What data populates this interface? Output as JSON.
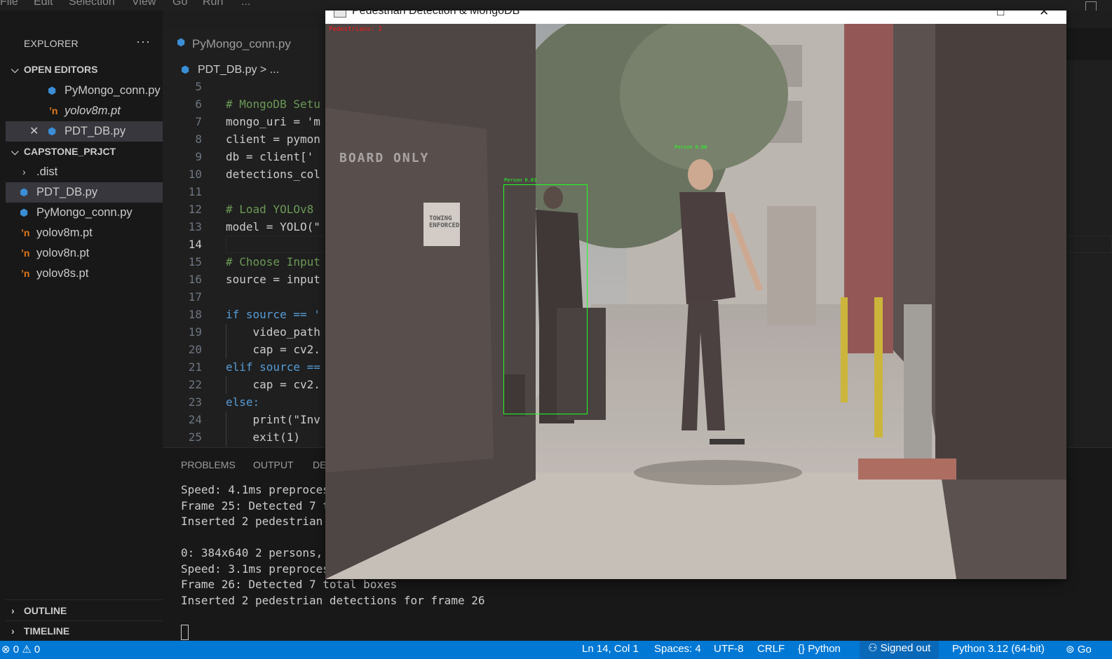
{
  "menu": {
    "items": [
      "File",
      "Edit",
      "Selection",
      "View",
      "Go",
      "Run",
      "..."
    ]
  },
  "explorer": {
    "title": "EXPLORER",
    "more": "···",
    "open_editors": {
      "label": "OPEN EDITORS",
      "files": [
        {
          "name": "PyMongo_conn.py",
          "icon": "python-file-icon"
        },
        {
          "name": "yolov8m.pt",
          "icon": "rss-file-icon"
        },
        {
          "name": "PDT_DB.py",
          "icon": "python-file-icon"
        }
      ]
    },
    "project": {
      "label": "CAPSTONE_PRJCT",
      "items": [
        {
          "name": ".dist",
          "icon": "chevron-right-icon"
        },
        {
          "name": "PDT_DB.py",
          "icon": "python-file-icon"
        },
        {
          "name": "PyMongo_conn.py",
          "icon": "python-file-icon"
        },
        {
          "name": "yolov8m.pt",
          "icon": "rss-file-icon"
        },
        {
          "name": "yolov8n.pt",
          "icon": "rss-file-icon"
        },
        {
          "name": "yolov8s.pt",
          "icon": "rss-file-icon"
        }
      ]
    },
    "outline": "OUTLINE",
    "timeline": "TIMELINE"
  },
  "tabs": [
    {
      "label": "PyMongo_conn.py"
    }
  ],
  "breadcrumb": "PDT_DB.py > ...",
  "editor": {
    "active_line": 14,
    "lines": [
      {
        "n": "5",
        "code": ""
      },
      {
        "n": "6",
        "code": "# MongoDB Setu"
      },
      {
        "n": "7",
        "code": "mongo_uri = 'm"
      },
      {
        "n": "8",
        "code": "client = pymon"
      },
      {
        "n": "9",
        "code": "db = client['"
      },
      {
        "n": "10",
        "code": "detections_col"
      },
      {
        "n": "11",
        "code": ""
      },
      {
        "n": "12",
        "code": "# Load YOLOv8"
      },
      {
        "n": "13",
        "code": "model = YOLO(\""
      },
      {
        "n": "14",
        "code": ""
      },
      {
        "n": "15",
        "code": "# Choose Input"
      },
      {
        "n": "16",
        "code": "source = input"
      },
      {
        "n": "17",
        "code": ""
      },
      {
        "n": "18",
        "code": "if source == '"
      },
      {
        "n": "19",
        "code": "    video_path"
      },
      {
        "n": "20",
        "code": "    cap = cv2."
      },
      {
        "n": "21",
        "code": "elif source =="
      },
      {
        "n": "22",
        "code": "    cap = cv2."
      },
      {
        "n": "23",
        "code": "else:"
      },
      {
        "n": "24",
        "code": "    print(\"Inv"
      },
      {
        "n": "25",
        "code": "    exit(1)"
      }
    ]
  },
  "panel": {
    "tabs": [
      "PROBLEMS",
      "OUTPUT",
      "DE"
    ],
    "terminal_lines": [
      "Speed: 4.1ms preproces",
      "Frame 25: Detected 7 t",
      "Inserted 2 pedestrian ",
      "",
      "0: 384x640 2 persons, ",
      "Speed: 3.1ms preproces",
      "Frame 26: Detected 7 total boxes",
      "Inserted 2 pedestrian detections for frame 26"
    ]
  },
  "video_window": {
    "title": "Pedestrian Detection & MongoDB",
    "overlay_count": "Pedestrians: 2",
    "detections": [
      {
        "label": "Person 0.83"
      },
      {
        "label": "Person 0.88"
      }
    ],
    "signs": [
      "BOARD ONLY",
      "TOWING ENFORCED"
    ]
  },
  "statusbar": {
    "errors": "0",
    "warnings": "0",
    "position": "Ln 14, Col 1",
    "spaces": "Spaces: 4",
    "encoding": "UTF-8",
    "eol": "CRLF",
    "language": "Python",
    "account": "Signed out",
    "interpreter": "Python 3.12 (64-bit)",
    "extra": "Go"
  },
  "colors": {
    "accent": "#0078d4",
    "bbox": "#22ff22",
    "overlay_text": "#ff1a1a",
    "python_icon": "#3b8ed6",
    "pt_icon": "#e2771a"
  }
}
